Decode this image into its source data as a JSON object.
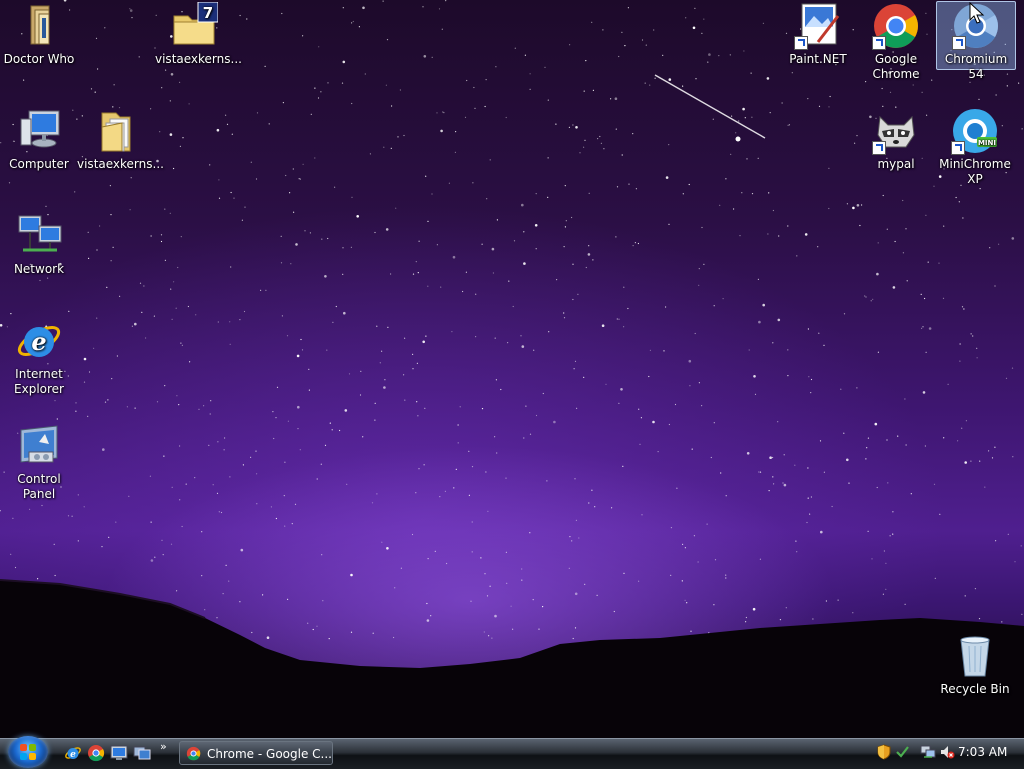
{
  "desktop": {
    "icons": [
      {
        "id": "doctor-who",
        "label": "Doctor Who",
        "icon": "folder-icon"
      },
      {
        "id": "vistaexkerns-1",
        "label": "vistaexkerns...",
        "icon": "archive-7z-icon"
      },
      {
        "id": "paint-net",
        "label": "Paint.NET",
        "icon": "paintnet-icon"
      },
      {
        "id": "google-chrome",
        "label": "Google Chrome",
        "icon": "chrome-icon"
      },
      {
        "id": "chromium-54",
        "label": "Chromium 54",
        "icon": "chromium-icon"
      },
      {
        "id": "computer",
        "label": "Computer",
        "icon": "computer-icon"
      },
      {
        "id": "vistaexkerns-2",
        "label": "vistaexkerns...",
        "icon": "folder-icon"
      },
      {
        "id": "mypal",
        "label": "mypal",
        "icon": "raccoon-icon"
      },
      {
        "id": "minichrome-xp",
        "label": "MiniChrome XP",
        "icon": "minichrome-icon"
      },
      {
        "id": "network",
        "label": "Network",
        "icon": "network-icon"
      },
      {
        "id": "internet-explorer",
        "label": "Internet Explorer",
        "icon": "ie-icon"
      },
      {
        "id": "control-panel",
        "label": "Control Panel",
        "icon": "control-panel-icon"
      },
      {
        "id": "recycle-bin",
        "label": "Recycle Bin",
        "icon": "recycle-bin-icon"
      }
    ],
    "selected_icon": "Chromium 54"
  },
  "taskbar": {
    "start_button": "windows-orb-icon",
    "quick_launch": [
      "ie-icon",
      "chrome-icon",
      "show-desktop-icon",
      "switch-windows-icon"
    ],
    "quick_launch_overflow": "»",
    "tasks": [
      {
        "label": "Chrome - Google C...",
        "icon": "chrome-icon",
        "active": true
      }
    ],
    "tray": {
      "icons": [
        "security-shield-icon",
        "network-icon",
        "volume-muted-icon"
      ],
      "clock": "7:03 AM"
    }
  },
  "colors": {
    "sky_top": "#1d0a2a",
    "sky_glow": "#4f1f8f",
    "taskbar": "#1a1e24",
    "selection": "#8cb4e6"
  }
}
